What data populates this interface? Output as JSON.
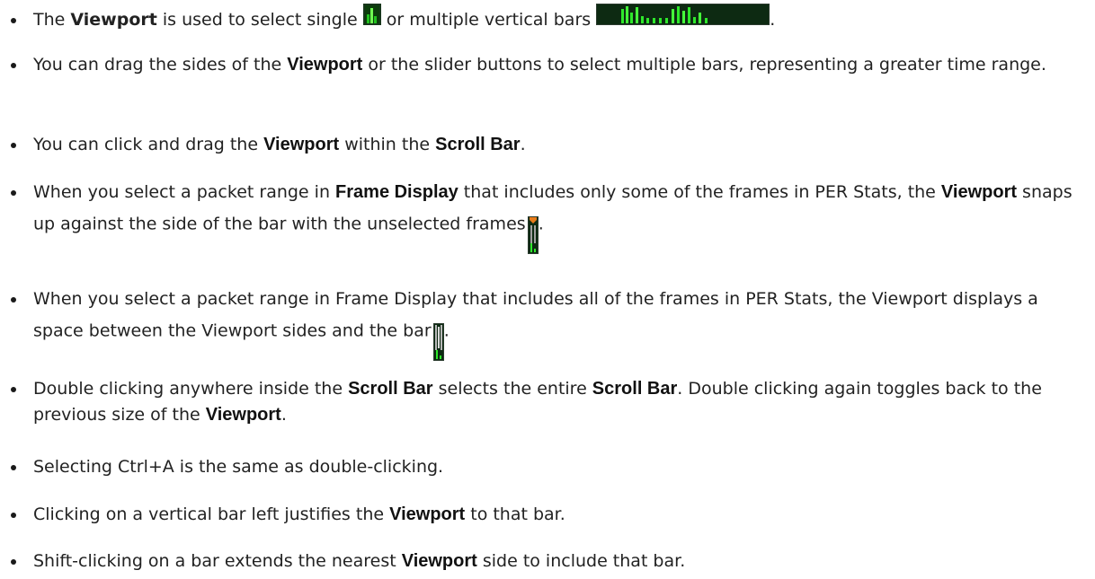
{
  "items": [
    {
      "pre": "The ",
      "b1": "Viewport",
      "mid": "  is used to select single ",
      "mid2": " or multiple vertical bars ",
      "post": "."
    },
    {
      "pre": "You can drag the sides of the ",
      "b1": "Viewport",
      "post": " or the slider buttons to select multiple bars, representing a greater time range."
    },
    {
      "pre": "You can click and drag the ",
      "b1": "Viewport",
      "mid": " within the ",
      "b2": "Scroll Bar",
      "post": "."
    },
    {
      "pre": "When you select a packet range in ",
      "b1": "Frame Display",
      "mid": " that includes only some of the frames in PER Stats, the ",
      "b2": "Viewport",
      "post": " snaps up against the side of the bar with the unselected frames ",
      "end": "."
    },
    {
      "pre": " When you select a packet range in Frame Display that includes all of the frames in PER Stats, the Viewport displays a space between the Viewport sides and the bar ",
      "end": "."
    },
    {
      "pre": "Double clicking anywhere inside the ",
      "b1": "Scroll Bar",
      "mid": " selects the entire ",
      "b2": "Scroll Bar",
      "mid2": ".  Double clicking again toggles back to the previous size of the ",
      "b3": "Viewport",
      "post": "."
    },
    {
      "pre": "Selecting Ctrl+A is the same as double-clicking."
    },
    {
      "pre": "Clicking on a vertical bar left justifies the ",
      "b1": "Viewport",
      "post": " to that bar."
    },
    {
      "pre": "Shift-clicking on a bar extends the nearest ",
      "b1": "Viewport",
      "post": " side to include that bar."
    }
  ],
  "icons": {
    "single_bar_colors": [
      "#0b3d0b",
      "#21c21f",
      "#6fff52"
    ],
    "multi_bar_bg": "#0d2a12",
    "multi_bar_fg": "#2ee82b",
    "viewport_handle": "#e77b1a"
  }
}
